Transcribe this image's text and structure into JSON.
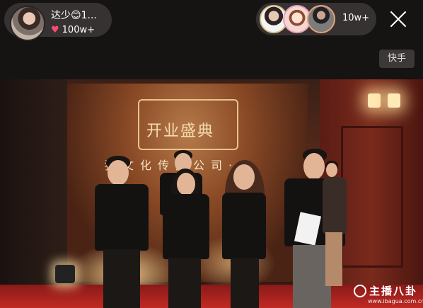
{
  "host": {
    "name": "达少😊1...",
    "likes": "100w+"
  },
  "viewers": {
    "count": "10w+"
  },
  "platform_badge": "快手",
  "scene": {
    "banner_title": "开业盛典",
    "banner_company": "猫文化传媒公司·"
  },
  "watermark": {
    "text": "主播八卦",
    "url": "www.ibagua.com.cn"
  },
  "icons": {
    "close": "close-icon",
    "heart": "heart-icon"
  },
  "colors": {
    "heart": "#ff4b6e",
    "floor": "#c02a24"
  }
}
